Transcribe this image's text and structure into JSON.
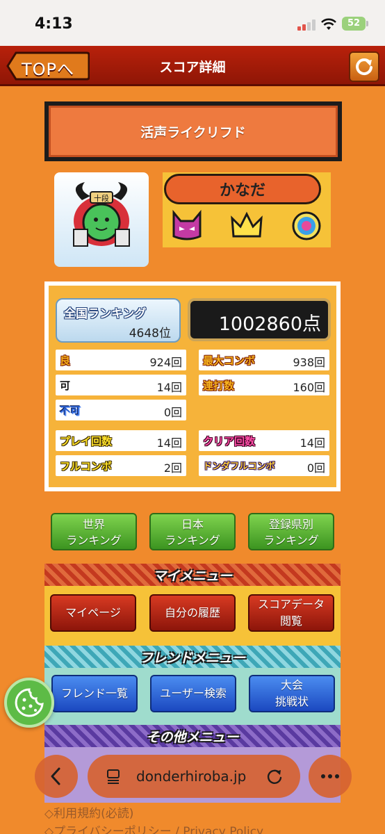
{
  "status_bar": {
    "time": "4:13",
    "battery": "52"
  },
  "header": {
    "back_label": "TOPへ",
    "title": "スコア詳細"
  },
  "song": {
    "title": "活声ライクリフド"
  },
  "player": {
    "name": "かなだ",
    "rank_badge_text": "十段",
    "badges": [
      "demon-face-icon",
      "crown-icon",
      "kiwami-icon"
    ]
  },
  "score": {
    "ranking_label": "全国ランキング",
    "ranking_value": "4648位",
    "points": "1002860点",
    "stats_left": [
      {
        "label": "良",
        "value": "924回"
      },
      {
        "label": "可",
        "value": "14回"
      },
      {
        "label": "不可",
        "value": "0回"
      }
    ],
    "stats_right": [
      {
        "label": "最大コンボ",
        "value": "938回"
      },
      {
        "label": "連打数",
        "value": "160回"
      }
    ],
    "stats_bottom_left": [
      {
        "label": "プレイ回数",
        "value": "14回"
      },
      {
        "label": "フルコンボ",
        "value": "2回"
      }
    ],
    "stats_bottom_right": [
      {
        "label": "クリア回数",
        "value": "14回"
      },
      {
        "label": "ドンダフルコンボ",
        "value": "0回"
      }
    ]
  },
  "ranking_buttons": [
    "世界\nランキング",
    "日本\nランキング",
    "登録県別\nランキング"
  ],
  "my_menu": {
    "title": "マイメニュー",
    "buttons": [
      "マイページ",
      "自分の履歴",
      "スコアデータ\n閲覧"
    ]
  },
  "friend_menu": {
    "title": "フレンドメニュー",
    "buttons": [
      "フレンド一覧",
      "ユーザー検索",
      "大会\n挑戦状"
    ]
  },
  "other_menu": {
    "title": "その他メニュー"
  },
  "footer_links": [
    "◇利用規約(必読)",
    "◇プライバシーポリシー / Privacy Policy"
  ],
  "browser": {
    "url": "donderhiroba.jp"
  },
  "colors": {
    "background": "#f08a2c",
    "header": "#a81c08",
    "accent_yellow": "#f6b33a"
  }
}
